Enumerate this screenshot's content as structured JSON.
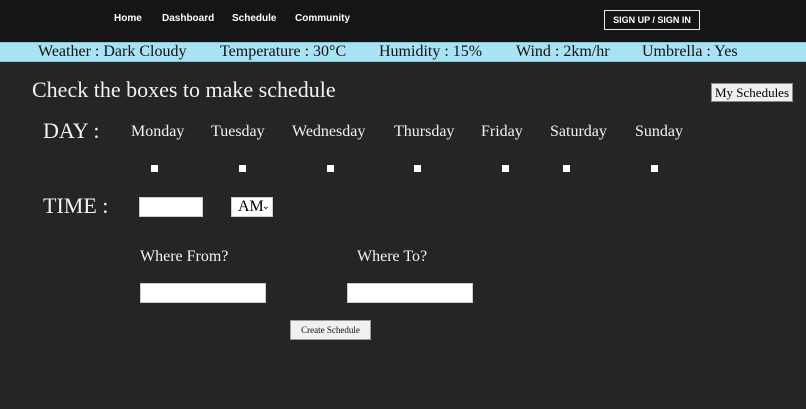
{
  "nav": {
    "links": [
      "Home",
      "Dashboard",
      "Schedule",
      "Community"
    ],
    "signup_label": "SIGN UP / SIGN IN"
  },
  "weather": {
    "weather": "Weather : Dark Cloudy",
    "temperature": "Temperature : 30°C",
    "humidity": "Humidity : 15%",
    "wind": "Wind : 2km/hr",
    "umbrella": "Umbrella : Yes"
  },
  "main": {
    "heading": "Check the boxes to make schedule",
    "my_schedules_label": "My Schedules",
    "day_label": "DAY :",
    "days": [
      "Monday",
      "Tuesday",
      "Wednesday",
      "Thursday",
      "Friday",
      "Saturday",
      "Sunday"
    ],
    "time_label": "TIME :",
    "time_value": "",
    "ampm_selected": "AM",
    "from_label": "Where From?",
    "from_value": "",
    "to_label": "Where To?",
    "to_value": "",
    "create_label": "Create Schedule"
  },
  "colors": {
    "background": "#252528",
    "nav_background": "#161416",
    "weather_bar": "#a9e2f3"
  }
}
